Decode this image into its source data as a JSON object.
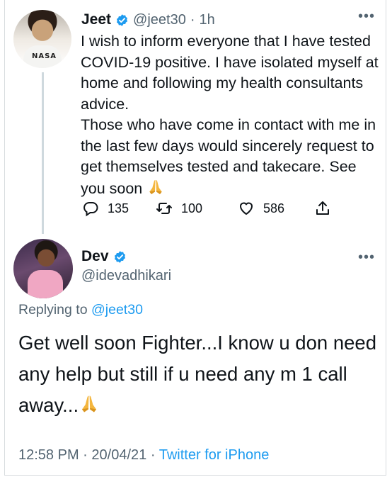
{
  "tweet": {
    "author_name": "Jeet",
    "author_handle": "@jeet30",
    "separator": "·",
    "time_ago": "1h",
    "text": "I wish to inform everyone that I have tested COVID-19 positive. I have isolated myself at home and following my health consultants advice.\nThose who have come in contact with me in the last few days would sincerely request to get themselves tested and takecare. See you soon",
    "emoji": "folded-hands-emoji",
    "replies": "135",
    "retweets": "100",
    "likes": "586",
    "more": "•••"
  },
  "reply": {
    "author_name": "Dev",
    "author_handle": "@idevadhikari",
    "replying_prefix": "Replying to",
    "replying_to": "@jeet30",
    "text": "Get well soon Fighter...I know u don need any help but still if u need any m 1 call away...",
    "emoji": "folded-hands-emoji",
    "time": "12:58 PM",
    "date": "20/04/21",
    "source": "Twitter for iPhone",
    "separator": "·",
    "more": "•••"
  },
  "colors": {
    "accent": "#1d9bf0",
    "secondary_text": "#536471",
    "primary_text": "#0f1419",
    "thread_line": "#cfd9de"
  }
}
